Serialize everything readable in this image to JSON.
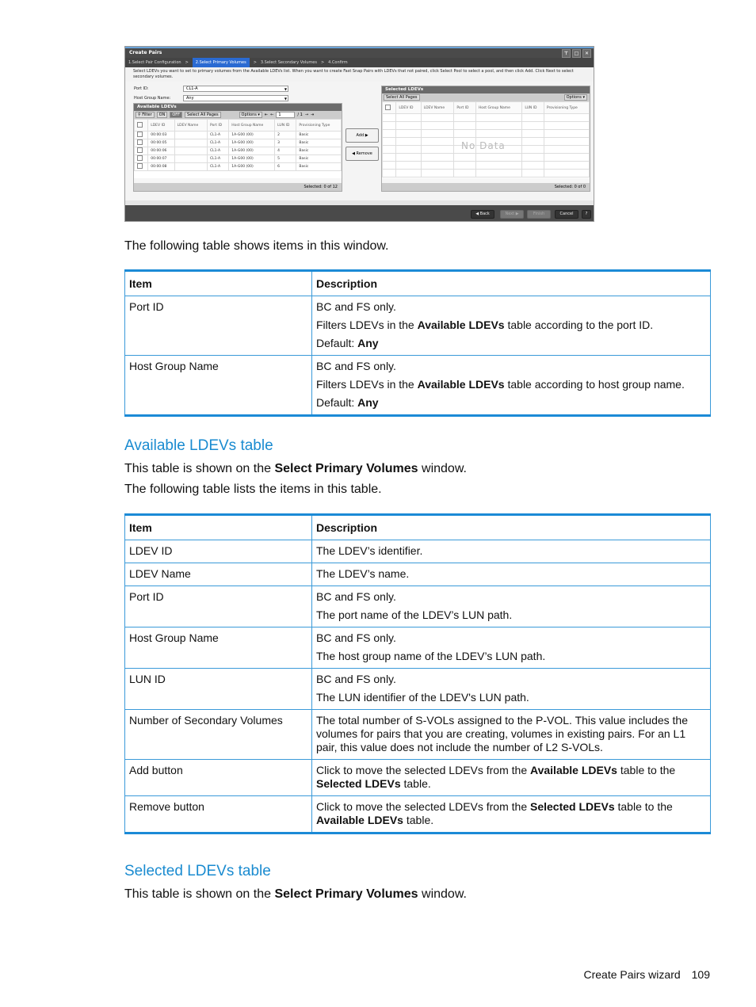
{
  "dialog": {
    "title": "Create Pairs",
    "steps": [
      "1.Select Pair Configuration",
      ">",
      "2.Select Primary Volumes",
      ">",
      "3.Select Secondary Volumes",
      ">",
      "4.Confirm"
    ],
    "current_step": "2.Select Primary Volumes",
    "instructions": "Select LDEVs you want to set to primary volumes from the Available LDEVs list. When you want to create Fast Snap Pairs with LDEVs that not paired, click Select Pool to select a pool, and then click Add. Click Next to select secondary volumes.",
    "port_id_label": "Port ID:",
    "port_id_value": "CL1-A",
    "host_group_label": "Host Group Name:",
    "host_group_value": "Any",
    "available": {
      "title": "Available LDEVs",
      "filter": "Filter",
      "on": "ON",
      "off": "OFF",
      "select_all": "Select All Pages",
      "options": "Options",
      "page": "1",
      "of_pages": "/ 1",
      "columns": [
        "LDEV ID",
        "LDEV Name",
        "Port ID",
        "Host Group Name",
        "LUN ID",
        "Provisioning Type"
      ],
      "rows": [
        [
          "00:00:03",
          "",
          "CL1-A",
          "1A-G00 (00)",
          "2",
          "Basic"
        ],
        [
          "00:00:05",
          "",
          "CL1-A",
          "1A-G00 (00)",
          "3",
          "Basic"
        ],
        [
          "00:00:06",
          "",
          "CL1-A",
          "1A-G00 (00)",
          "4",
          "Basic"
        ],
        [
          "00:00:07",
          "",
          "CL1-A",
          "1A-G00 (00)",
          "5",
          "Basic"
        ],
        [
          "00:00:08",
          "",
          "CL1-A",
          "1A-G00 (00)",
          "6",
          "Basic"
        ]
      ],
      "selected_text": "Selected:  0   of  12"
    },
    "add_button": "Add ▶",
    "remove_button": "◀ Remove",
    "selected": {
      "title": "Selected LDEVs",
      "select_all": "Select All Pages",
      "options": "Options",
      "columns": [
        "LDEV ID",
        "LDEV Name",
        "Port ID",
        "Host Group Name",
        "LUN ID",
        "Provisioning Type"
      ],
      "no_data": "No Data",
      "selected_text": "Selected:  0   of  0"
    },
    "buttons": {
      "back": "◀ Back",
      "next": "Next ▶",
      "finish": "Finish",
      "cancel": "Cancel",
      "help": "?"
    }
  },
  "intro1": "The following table shows items in this window.",
  "table1": {
    "headers": [
      "Item",
      "Description"
    ],
    "rows": [
      {
        "item": "Port ID",
        "lines": [
          "BC and FS only.",
          "Filters LDEVs in the |Available LDEVs| table according to the port ID.",
          "Default: |Any|"
        ]
      },
      {
        "item": "Host Group Name",
        "lines": [
          "BC and FS only.",
          "Filters LDEVs in the |Available LDEVs| table according to host group name.",
          "Default: |Any|"
        ]
      }
    ]
  },
  "section1": {
    "heading": "Available LDEVs table",
    "line1_pre": "This table is shown on the ",
    "line1_bold": "Select Primary Volumes",
    "line1_post": " window.",
    "line2": "The following table lists the items in this table."
  },
  "table2": {
    "headers": [
      "Item",
      "Description"
    ],
    "rows": [
      {
        "item": "LDEV ID",
        "lines": [
          "The LDEV’s identifier."
        ]
      },
      {
        "item": "LDEV Name",
        "lines": [
          "The LDEV’s name."
        ]
      },
      {
        "item": "Port ID",
        "lines": [
          "BC and FS only.",
          "The port name of the LDEV’s LUN path."
        ]
      },
      {
        "item": "Host Group Name",
        "lines": [
          "BC and FS only.",
          "The host group name of the LDEV’s LUN path."
        ]
      },
      {
        "item": "LUN ID",
        "lines": [
          "BC and FS only.",
          "The LUN identifier of the LDEV's LUN path."
        ]
      },
      {
        "item": "Number of Secondary Volumes",
        "lines": [
          "The total number of S-VOLs assigned to the P-VOL. This value includes the volumes for pairs that you are creating, volumes in existing pairs. For an L1 pair, this value does not include the number of L2 S-VOLs."
        ]
      },
      {
        "item": "Add button",
        "lines": [
          "Click to move the selected LDEVs from the |Available LDEVs| table to the |Selected LDEVs| table."
        ]
      },
      {
        "item": "Remove button",
        "lines": [
          "Click to move the selected LDEVs from the |Selected LDEVs| table to the |Available LDEVs| table."
        ]
      }
    ]
  },
  "section2": {
    "heading": "Selected LDEVs table",
    "line1_pre": "This table is shown on the ",
    "line1_bold": "Select Primary Volumes",
    "line1_post": " window."
  },
  "footer": {
    "title": "Create Pairs wizard",
    "page": "109"
  }
}
